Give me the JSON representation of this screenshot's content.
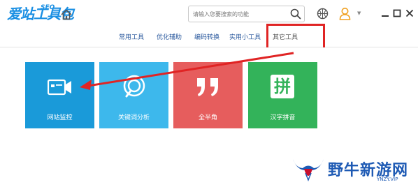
{
  "app": {
    "logo_text": "爱站工具包",
    "logo_badge": "SEO"
  },
  "search": {
    "placeholder": "请输入您要搜索的功能"
  },
  "window_controls": {
    "minimize": "—",
    "maximize": "□",
    "close": "✕"
  },
  "tabs": [
    {
      "label": "常用工具",
      "active": false
    },
    {
      "label": "优化辅助",
      "active": false
    },
    {
      "label": "编码转换",
      "active": false
    },
    {
      "label": "实用小工具",
      "active": false
    },
    {
      "label": "其它工具",
      "active": true
    }
  ],
  "tiles": [
    {
      "label": "网站监控",
      "color": "#1a9ad9",
      "icon": "camera-icon"
    },
    {
      "label": "关键词分析",
      "color": "#3db8ec",
      "icon": "magnifier-icon"
    },
    {
      "label": "全半角",
      "color": "#e65d5d",
      "icon": "quote-icon"
    },
    {
      "label": "汉字拼音",
      "color": "#33b35a",
      "icon": "pinyin-icon",
      "icon_char": "拼"
    }
  ],
  "colors": {
    "accent": "#1a8fe3",
    "annotation": "#e02424",
    "tab_text": "#2b5a9e"
  },
  "watermark": {
    "text": "野牛新游网",
    "url": "YNZY.VIP"
  }
}
